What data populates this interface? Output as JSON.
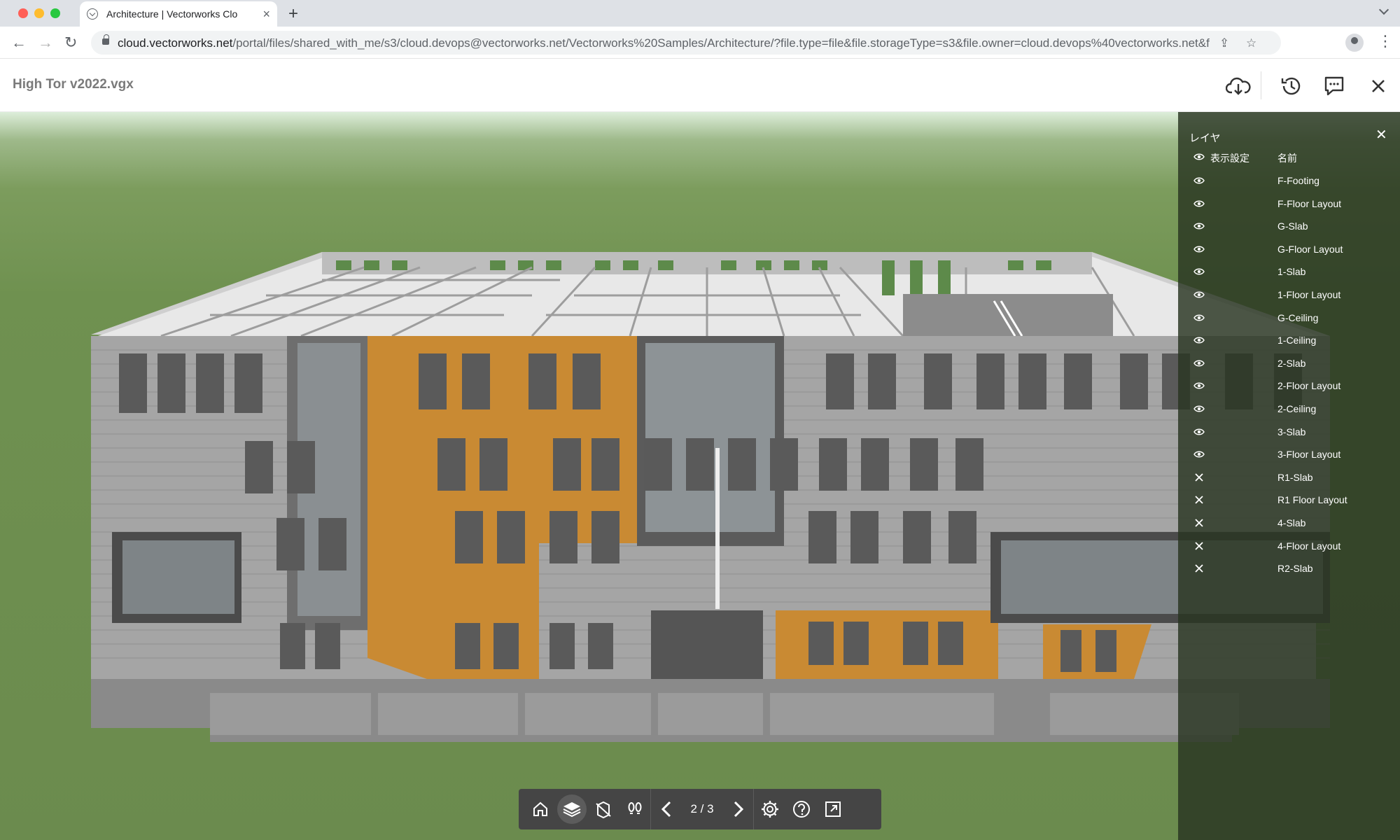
{
  "browser": {
    "tab_title": "Architecture | Vectorworks Clo",
    "url_host": "cloud.vectorworks.net",
    "url_path": "/portal/files/shared_with_me/s3/cloud.devops@vectorworks.net/Vectorworks%20Samples/Architecture/?file.type=file&file.storageType=s3&file.owner=cloud.devops%40vectorworks.net&f..."
  },
  "app": {
    "file_title": "High Tor v2022.vgx"
  },
  "layers_panel": {
    "title": "レイヤ",
    "col_visibility": "表示設定",
    "col_name": "名前",
    "layers": [
      {
        "name": "F-Footing",
        "visible": true
      },
      {
        "name": "F-Floor Layout",
        "visible": true
      },
      {
        "name": "G-Slab",
        "visible": true
      },
      {
        "name": "G-Floor Layout",
        "visible": true
      },
      {
        "name": "1-Slab",
        "visible": true
      },
      {
        "name": "1-Floor Layout",
        "visible": true
      },
      {
        "name": "G-Ceiling",
        "visible": true
      },
      {
        "name": "1-Ceiling",
        "visible": true
      },
      {
        "name": "2-Slab",
        "visible": true
      },
      {
        "name": "2-Floor Layout",
        "visible": true
      },
      {
        "name": "2-Ceiling",
        "visible": true
      },
      {
        "name": "3-Slab",
        "visible": true
      },
      {
        "name": "3-Floor Layout",
        "visible": true
      },
      {
        "name": "R1-Slab",
        "visible": false
      },
      {
        "name": "R1 Floor Layout",
        "visible": false
      },
      {
        "name": "4-Slab",
        "visible": false
      },
      {
        "name": "4-Floor Layout",
        "visible": false
      },
      {
        "name": "R2-Slab",
        "visible": false
      }
    ]
  },
  "bottom_toolbar": {
    "page_indicator": "2 / 3"
  },
  "colors": {
    "grass": "#6f9150",
    "panel_bg": "#283421",
    "cladding_orange": "#c98a33",
    "wall_grey": "#9a9a9a",
    "toolbar_bg": "#454545"
  }
}
